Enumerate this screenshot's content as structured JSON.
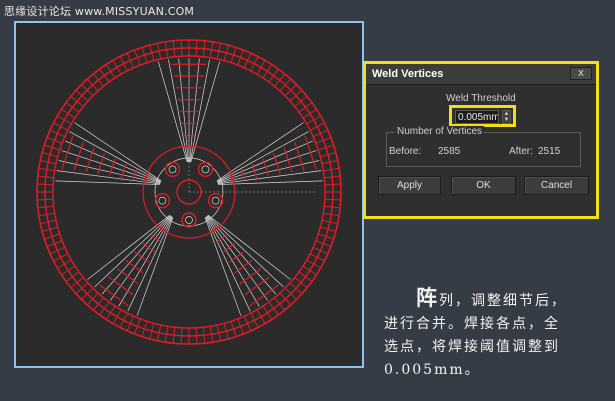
{
  "watermark": "思缘设计论坛 www.MISSYUAN.COM",
  "dialog": {
    "title": "Weld Vertices",
    "close_glyph": "x",
    "threshold_label": "Weld Threshold",
    "threshold_value": "0.005mm",
    "spinner_up": "▲",
    "spinner_down": "▼",
    "group_title": "Number of Vertices",
    "before_label": "Before:",
    "before_value": "2585",
    "after_label": "After:",
    "after_value": "2515",
    "buttons": {
      "apply": "Apply",
      "ok": "OK",
      "cancel": "Cancel"
    }
  },
  "caption": {
    "first_char": "阵",
    "rest_line1": "列，调整细节后，",
    "line2": "进行合并。焊接各点，全",
    "line3": "选点，将焊接阈值调整到",
    "line4": "0.005mm。"
  },
  "colors": {
    "background": "#353c46",
    "viewport_bg": "#2b2b2b",
    "viewport_border": "#8ec3ee",
    "highlight": "#f2dd19",
    "wire_red": "#e01c24",
    "wire_white": "#d8d8d8"
  },
  "icons": {
    "close": "close-icon",
    "spinner": "spinner-icon"
  }
}
